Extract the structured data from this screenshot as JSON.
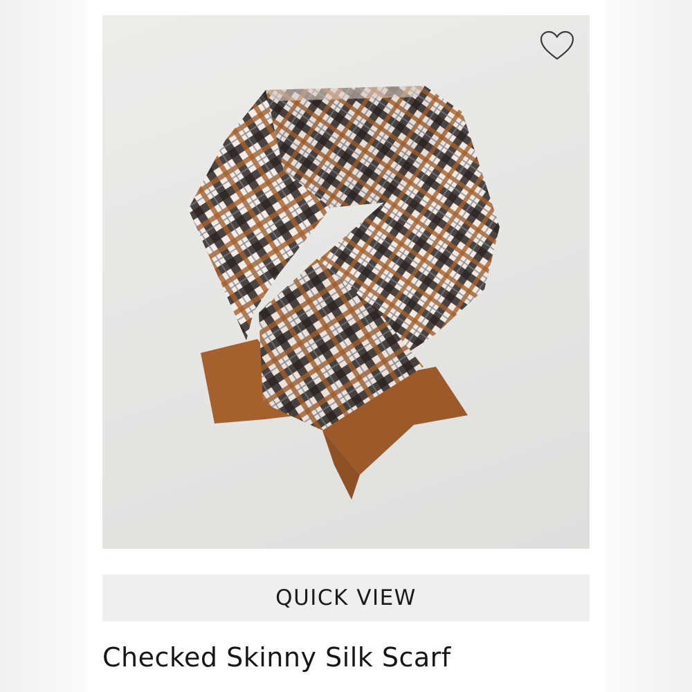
{
  "product": {
    "title": "Checked Skinny Silk Scarf",
    "image_icon": "checked-scarf-image",
    "wishlist_icon": "heart-outline-icon"
  },
  "actions": {
    "quick_view_label": "QUICK VIEW"
  },
  "colors": {
    "image_background": "#e6e6e5",
    "scarf_brown": "#a4602d",
    "check_dark": "#2b2624",
    "check_cream": "#f4ece6",
    "button_background": "#efefef",
    "text": "#161616"
  }
}
